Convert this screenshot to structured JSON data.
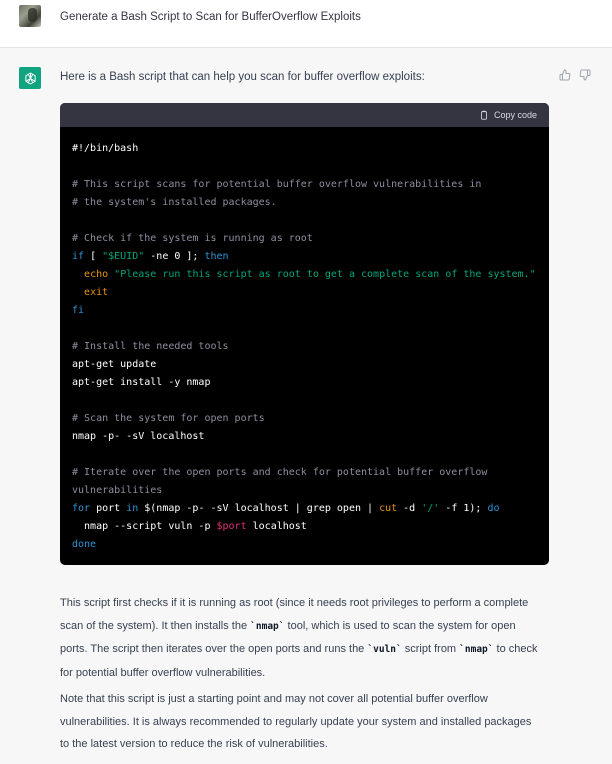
{
  "conversation": {
    "user_prompt": "Generate a Bash Script to Scan for BufferOverflow Exploits",
    "assistant_intro": "Here is a Bash script that can help you scan for buffer overflow exploits:"
  },
  "code_block": {
    "copy_label": "Copy code",
    "lines": [
      "#!/bin/bash",
      "",
      "# This script scans for potential buffer overflow vulnerabilities in",
      "# the system's installed packages.",
      "",
      "# Check if the system is running as root",
      "if [ \"$EUID\" -ne 0 ]; then",
      "  echo \"Please run this script as root to get a complete scan of the system.\"",
      "  exit",
      "fi",
      "",
      "# Install the needed tools",
      "apt-get update",
      "apt-get install -y nmap",
      "",
      "# Scan the system for open ports",
      "nmap -p- -sV localhost",
      "",
      "# Iterate over the open ports and check for potential buffer overflow",
      "vulnerabilities",
      "for port in $(nmap -p- -sV localhost | grep open | cut -d '/' -f 1); do",
      "  nmap --script vuln -p $port localhost",
      "done"
    ]
  },
  "explanation": {
    "p1_a": "This script first checks if it is running as root (since it needs root privileges to perform a complete scan of the system). It then installs the ",
    "p1_code1": "`nmap`",
    "p1_b": " tool, which is used to scan the system for open ports. The script then iterates over the open ports and runs the ",
    "p1_code2": "`vuln`",
    "p1_c": " script from ",
    "p1_code3": "`nmap`",
    "p1_d": " to check for potential buffer overflow vulnerabilities.",
    "p2": "Note that this script is just a starting point and may not cover all potential buffer overflow vulnerabilities. It is always recommended to regularly update your system and installed packages to the latest version to reduce the risk of vulnerabilities."
  },
  "icons": {
    "user_avatar": "user-avatar-photo",
    "bot_avatar": "openai-logo-icon",
    "thumbs_up": "thumbs-up-icon",
    "thumbs_down": "thumbs-down-icon",
    "copy": "clipboard-icon"
  },
  "colors": {
    "bot_avatar_bg": "#10a37f",
    "code_bg": "#000000",
    "code_header_bg": "#343541",
    "comment": "#8e8ea0",
    "keyword": "#2e95d3",
    "string": "#00a67d",
    "variable": "#df3079",
    "builtin": "#e9950c"
  }
}
